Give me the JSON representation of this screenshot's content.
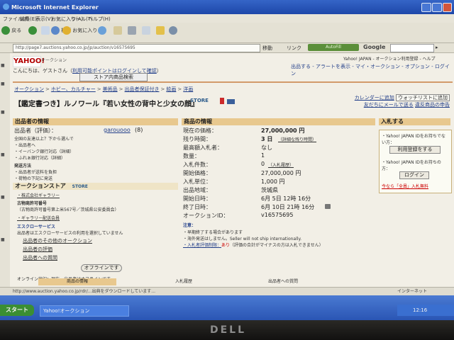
{
  "window": {
    "title": "Microsoft Internet Explorer"
  },
  "menubar": {
    "items": [
      "ファイル(F)",
      "編集(E)",
      "表示(V)",
      "お気に入り(A)",
      "ツール(T)",
      "ヘルプ(H)"
    ]
  },
  "toolbar": {
    "back_label": "戻る",
    "search_label": "検索",
    "favorites_label": "お気に入り"
  },
  "addressbar": {
    "url": "http://page7.auctions.yahoo.co.jp/jp/auction/v16575695",
    "go_label": "移動",
    "links_label": "リンク",
    "pill_label": "AutoFill",
    "google_label": "Google"
  },
  "header": {
    "logo_text": "YAHOO!",
    "logo_sub": "オークション",
    "greeting_prefix": "こんにちは、ゲストさん（",
    "greeting_link": "利用可能ポイントはログインして確認",
    "greeting_suffix": "）",
    "store_search_button": "ストア内商品検索",
    "top_right": "Yahoo! JAPAN - オークション利用登録 - ヘルプ",
    "links_right": "出品する - アラートを表示 - マイ・オークション - オプション - ログイン"
  },
  "breadcrumb": [
    "オークション",
    "ホビー、カルチャー",
    "美術品",
    "出品者保証付き",
    "絵画",
    "洋画"
  ],
  "item": {
    "title": "【鑑定書つき】ルノワール『若い女性の背中と少女の顔』",
    "store_badge": "STORE"
  },
  "right_links": {
    "calendar_link": "カレンダーに追加",
    "watch_button": "ウォッチリストに追加",
    "friend_link": "友だちにメールで送る",
    "violation_link": "違反商品の申告"
  },
  "seller_info": {
    "header": "出品者の情報",
    "seller_label": "出品者（評価）：",
    "seller_id": "garouooo",
    "seller_rating": "(8)",
    "notes": [
      "全国の友達以上？下から選んで",
      "・出品者へ",
      "・イーバンク銀行対応（詳細）",
      "・ふれぁ銀行対応（詳細）"
    ],
    "shipping_header": "発送方法",
    "shipping_item1": "・出品者が送料を負担",
    "shipping_item2": "・荷物の下記に発送",
    "store_header": "オークションストア",
    "store_badge": "STORE",
    "company_name": "・株式会社ギャラリー",
    "license_header": "古物商許可番号",
    "license_text": "（古物商許可番号第上米567号／茨城県公安委員会）",
    "link_gallery": "・ギャラリー配送会員",
    "escrow_header": "エスクローサービス",
    "escrow_text": "出品者はエスクローサービスの利用を選択していません",
    "other_auctions": "出品者のその他のオークション",
    "reviews": "出品者の評価",
    "questions": "出品者への質問",
    "offline_label": "オフラインです",
    "online_status": "オンライン状況：現在、出品者はオフラインです"
  },
  "product_info": {
    "header": "商品の情報",
    "rows": [
      {
        "label": "現在の価格：",
        "value": "27,000,000 円"
      },
      {
        "label": "残り時間：",
        "value": "3 日",
        "extra": "（詳細な残り時間）"
      },
      {
        "label": "最高額入札者：",
        "value": "なし"
      },
      {
        "label": "数量：",
        "value": "1"
      },
      {
        "label": "入札件数：",
        "value": "0",
        "extra": "（入札履歴）"
      },
      {
        "label": "開始価格：",
        "value": "27,000,000 円"
      },
      {
        "label": "入札単位：",
        "value": "1,000 円"
      },
      {
        "label": "出品地域：",
        "value": "茨城県"
      },
      {
        "label": "開始日時：",
        "value": "6月 5日 12時 16分"
      },
      {
        "label": "終了日時：",
        "value": "6月 10日 21時 16分"
      },
      {
        "label": "オークションID：",
        "value": "v16575695"
      }
    ],
    "notes_header": "注意：",
    "note1": "・早期終了する場合があります",
    "note2": "・海外発送はしません。Seller will not ship internationally.",
    "note3_label": "・入札者評価制限：",
    "note3_value": "あり",
    "note3_tail": "（評価の合計がマイナスの方は入札できません）"
  },
  "bid_box": {
    "header": "入札する",
    "text1": "・Yahoo! JAPAN IDをお持ちでない方：",
    "register_button": "利用登録をする",
    "text2": "・Yahoo! JAPAN IDをお持ちの方：",
    "login_button": "ログイン",
    "promo_link": "今なら「全員」入札無料"
  },
  "bottom_tabs": [
    "商品の情報",
    "入札履歴",
    "出品者への質問"
  ],
  "statusbar": {
    "url": "http://www.auction.yahoo.co.jp/rdr/...出典をダウンロードしています...",
    "zone": "インターネット"
  },
  "taskbar": {
    "start": "スタート",
    "task": "Yahoo!オークション",
    "tray_time": "12:16"
  },
  "bezel": {
    "brand": "DELL"
  }
}
